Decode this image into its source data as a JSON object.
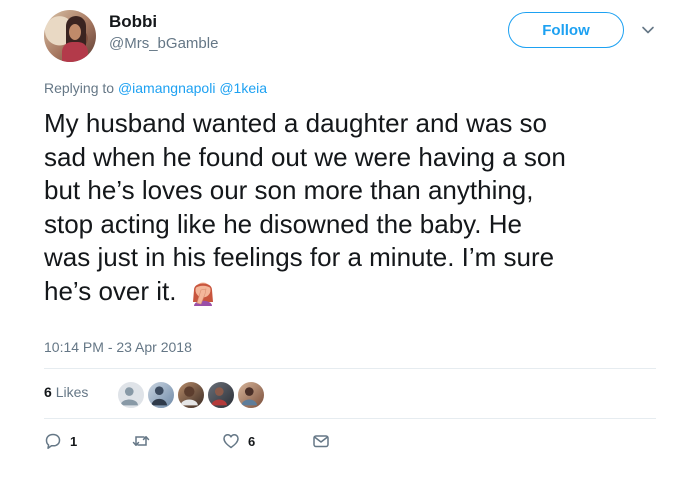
{
  "user": {
    "display_name": "Bobbi",
    "handle": "@Mrs_bGamble"
  },
  "follow_label": "Follow",
  "reply_context": {
    "prefix": "Replying to",
    "mentions": [
      "@iamangnapoli",
      "@1keia"
    ]
  },
  "tweet": {
    "lines": [
      "My husband wanted a daughter and was so",
      "sad when he found out we were having a son",
      "but he’s loves our son more than anything,",
      "stop acting like he disowned the baby. He",
      "was just in his feelings for a minute. I’m sure",
      "he’s over it."
    ],
    "emoji": "woman-facepalming-emoji",
    "timestamp": "10:14 PM - 23 Apr 2018"
  },
  "stats": {
    "likes_count": "6",
    "likes_label": "Likes"
  },
  "actions": {
    "reply_count": "1",
    "retweet_count": "",
    "like_count": "6"
  },
  "colors": {
    "accent": "#1da1f2",
    "secondary_text": "#657786",
    "divider": "#e6ecf0"
  }
}
